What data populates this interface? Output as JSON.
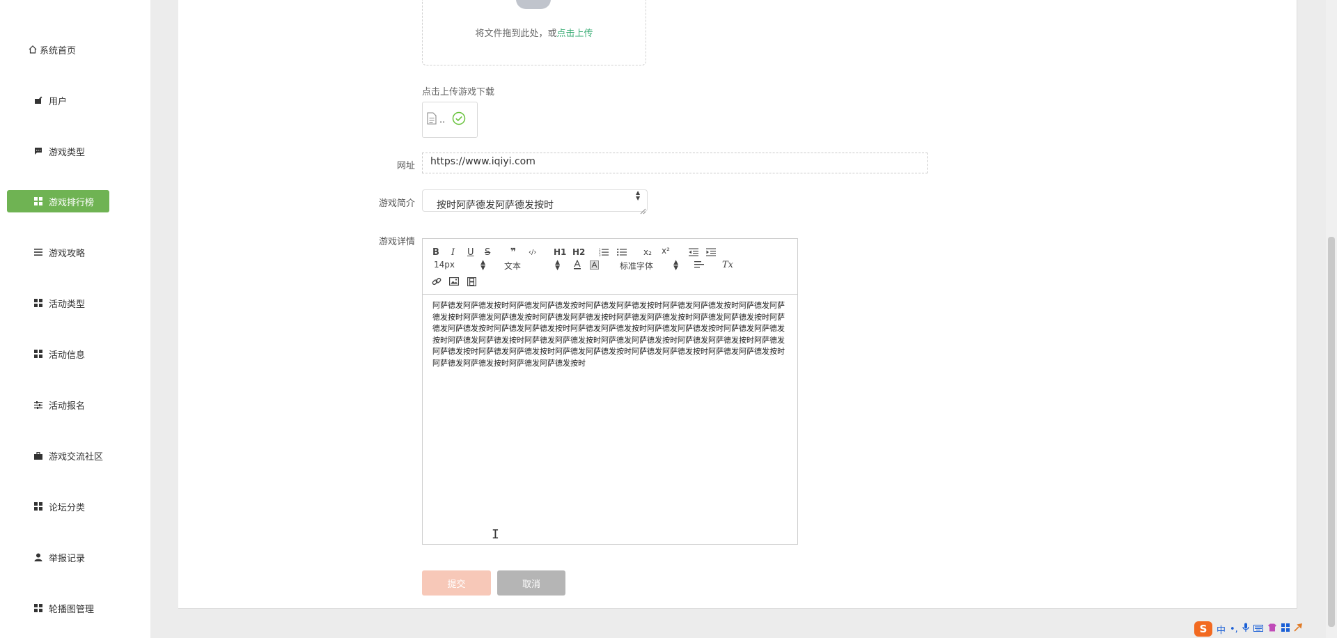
{
  "sidebar": {
    "items": [
      {
        "label": "系统首页",
        "icon": "home-icon",
        "active": false
      },
      {
        "label": "用户",
        "icon": "user-icon",
        "active": false
      },
      {
        "label": "游戏类型",
        "icon": "chat-icon",
        "active": false
      },
      {
        "label": "游戏排行榜",
        "icon": "grid-icon",
        "active": true
      },
      {
        "label": "游戏攻略",
        "icon": "list-icon",
        "active": false
      },
      {
        "label": "活动类型",
        "icon": "grid-icon",
        "active": false
      },
      {
        "label": "活动信息",
        "icon": "grid-icon",
        "active": false
      },
      {
        "label": "活动报名",
        "icon": "sliders-icon",
        "active": false
      },
      {
        "label": "游戏交流社区",
        "icon": "briefcase-icon",
        "active": false
      },
      {
        "label": "论坛分类",
        "icon": "grid-icon",
        "active": false
      },
      {
        "label": "举报记录",
        "icon": "person-icon",
        "active": false
      },
      {
        "label": "轮播图管理",
        "icon": "grid-icon",
        "active": false
      }
    ]
  },
  "form": {
    "upload_hint": "将文件拖到此处，或",
    "upload_link": "点击上传",
    "download_label": "点击上传游戏下载",
    "file_name": "..",
    "url_label": "网址",
    "url_value": "https://www.iqiyi.com",
    "intro_label": "游戏简介",
    "intro_value": "按时阿萨德发阿萨德发按时",
    "detail_label": "游戏详情",
    "detail_text": "阿萨德发阿萨德发按时阿萨德发阿萨德发按时阿萨德发阿萨德发按时阿萨德发阿萨德发按时阿萨德发阿萨德发按时阿萨德发阿萨德发按时阿萨德发阿萨德发按时阿萨德发阿萨德发按时阿萨德发阿萨德发按时阿萨德发阿萨德发按时阿萨德发阿萨德发按时阿萨德发阿萨德发按时阿萨德发阿萨德发按时阿萨德发阿萨德发按时阿萨德发阿萨德发按时阿萨德发阿萨德发按时阿萨德发阿萨德发按时阿萨德发阿萨德发按时阿萨德发阿萨德发按时阿萨德发阿萨德发按时阿萨德发阿萨德发按时阿萨德发阿萨德发按时阿萨德发阿萨德发按时阿萨德发阿萨德发按时阿萨德发阿萨德发按时",
    "submit_label": "提交",
    "cancel_label": "取消"
  },
  "editor_toolbar": {
    "bold": "B",
    "italic": "I",
    "underline": "U",
    "strike": "S",
    "quote": "❞",
    "code": "‹/›",
    "h1": "H1",
    "h2": "H2",
    "sub": "x₂",
    "sup": "x²",
    "clean": "Tx",
    "size_value": "14px",
    "heading_value": "文本",
    "font_value": "标准字体"
  },
  "ime": {
    "lang": "中"
  },
  "colors": {
    "active": "#6fb353",
    "link": "#3aad75",
    "submit": "#f7c8b8",
    "cancel": "#b5b5b5"
  }
}
